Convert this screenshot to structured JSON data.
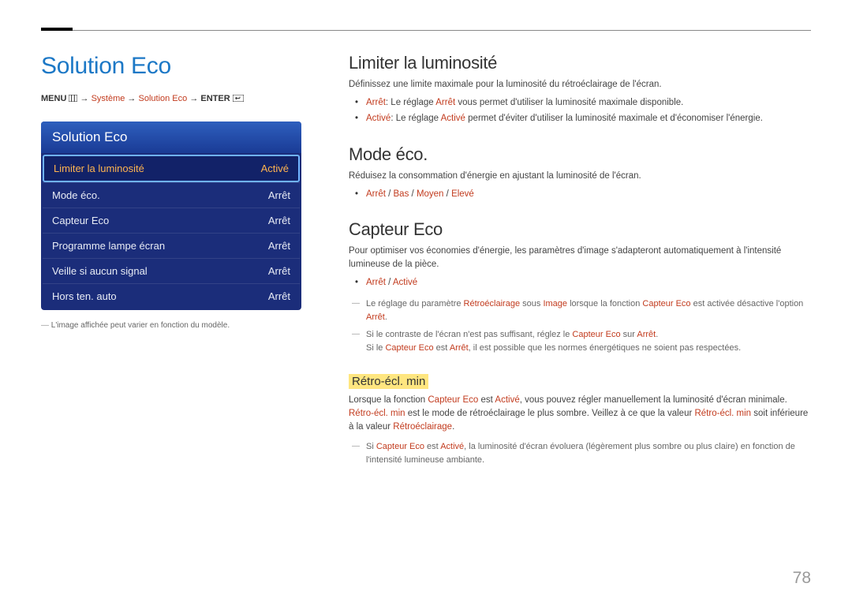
{
  "page_number": "78",
  "main_title": "Solution Eco",
  "breadcrumb": {
    "prefix": "MENU",
    "parts": [
      "Système",
      "Solution Eco"
    ],
    "suffix": "ENTER"
  },
  "menu": {
    "header": "Solution Eco",
    "items": [
      {
        "label": "Limiter la luminosité",
        "value": "Activé",
        "selected": true
      },
      {
        "label": "Mode éco.",
        "value": "Arrêt",
        "selected": false
      },
      {
        "label": "Capteur Eco",
        "value": "Arrêt",
        "selected": false
      },
      {
        "label": "Programme lampe écran",
        "value": "Arrêt",
        "selected": false
      },
      {
        "label": "Veille si aucun signal",
        "value": "Arrêt",
        "selected": false
      },
      {
        "label": "Hors ten. auto",
        "value": "Arrêt",
        "selected": false
      }
    ]
  },
  "disclaimer": "L'image affichée peut varier en fonction du modèle.",
  "sections": {
    "s1": {
      "title": "Limiter la luminosité",
      "desc": "Définissez une limite maximale pour la luminosité du rétroéclairage de l'écran.",
      "b1_label": "Arrêt",
      "b1_mid": ": Le réglage ",
      "b1_label2": "Arrêt",
      "b1_rest": " vous permet d'utiliser la luminosité maximale disponible.",
      "b2_label": "Activé",
      "b2_mid": ": Le réglage ",
      "b2_label2": "Activé",
      "b2_rest": " permet d'éviter d'utiliser la luminosité maximale et d'économiser l'énergie."
    },
    "s2": {
      "title": "Mode éco.",
      "desc": "Réduisez la consommation d'énergie en ajustant la luminosité de l'écran.",
      "opts": {
        "a": "Arrêt",
        "b": "Bas",
        "c": "Moyen",
        "d": "Elevé",
        "sep": " / "
      }
    },
    "s3": {
      "title": "Capteur Eco",
      "desc": "Pour optimiser vos économies d'énergie, les paramètres d'image s'adapteront automatiquement à l'intensité lumineuse de la pièce.",
      "opts": {
        "a": "Arrêt",
        "b": "Activé",
        "sep": " / "
      },
      "n1_a": "Le réglage du paramètre ",
      "n1_b": "Rétroéclairage",
      "n1_c": " sous ",
      "n1_d": "Image",
      "n1_e": " lorsque la fonction ",
      "n1_f": "Capteur Eco",
      "n1_g": " est activée désactive l'option ",
      "n1_h": "Arrêt",
      "n1_i": ".",
      "n2_a": "Si le contraste de l'écran n'est pas suffisant, réglez le ",
      "n2_b": "Capteur Eco",
      "n2_c": " sur ",
      "n2_d": "Arrêt",
      "n2_e": ".",
      "n2_f": "Si le ",
      "n2_g": "Capteur Eco",
      "n2_h": " est ",
      "n2_i": "Arrêt",
      "n2_j": ", il est possible que les normes énergétiques ne soient pas respectées."
    },
    "s4": {
      "title": "Rétro-écl. min",
      "p_a": "Lorsque la fonction ",
      "p_b": "Capteur Eco",
      "p_c": " est ",
      "p_d": "Activé",
      "p_e": ", vous pouvez régler manuellement la luminosité d'écran minimale. ",
      "p_f": "Rétro-écl. min",
      "p_g": " est le mode de rétroéclairage le plus sombre. Veillez à ce que la valeur ",
      "p_h": "Rétro-écl. min",
      "p_i": " soit inférieure à la valeur ",
      "p_j": "Rétroéclairage",
      "p_k": ".",
      "n_a": "Si ",
      "n_b": "Capteur Eco",
      "n_c": " est ",
      "n_d": "Activé",
      "n_e": ", la luminosité d'écran évoluera (légèrement plus sombre ou plus claire) en fonction de l'intensité lumineuse ambiante."
    }
  }
}
